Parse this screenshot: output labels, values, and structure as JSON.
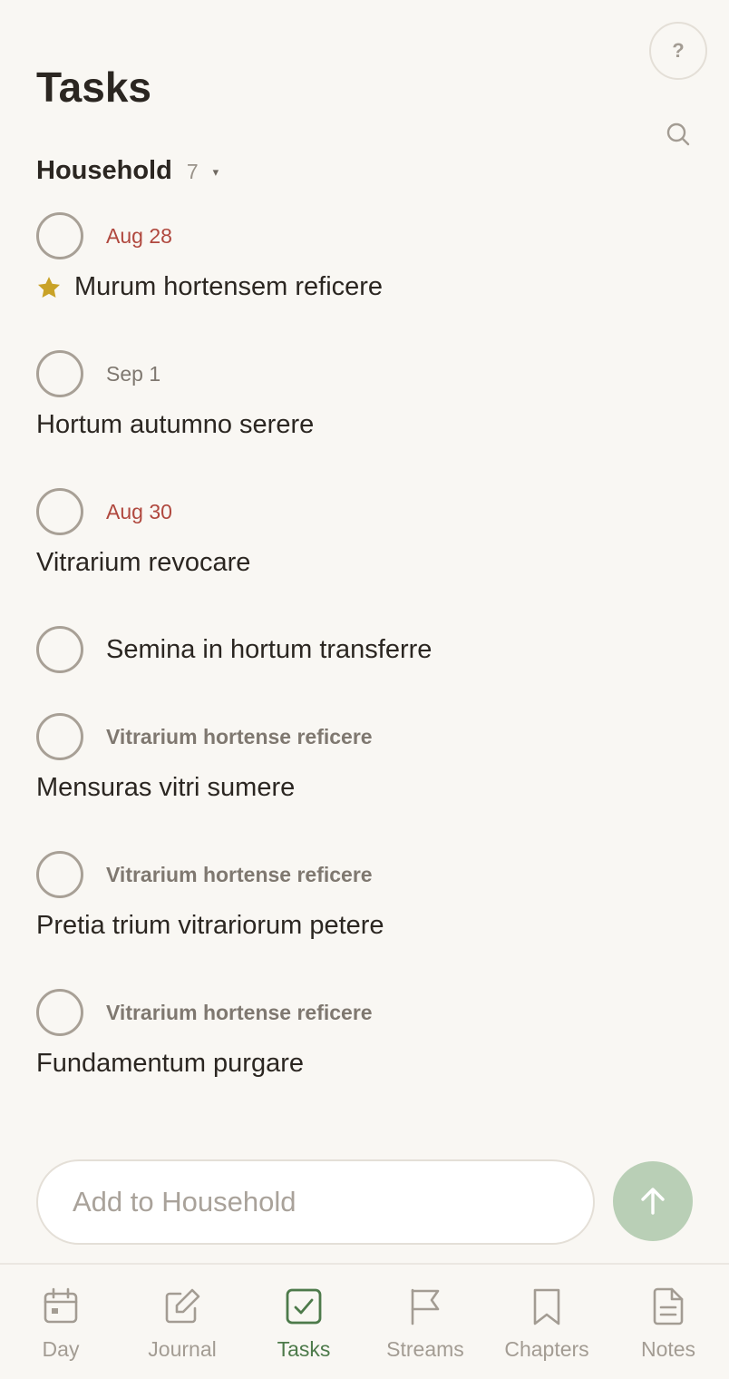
{
  "header": {
    "title": "Tasks",
    "help_label": "?"
  },
  "list": {
    "name": "Household",
    "count": "7",
    "caret": "▾"
  },
  "tasks": [
    {
      "meta": "Aug 28",
      "meta_type": "overdue",
      "title": "Murum hortensem reficere",
      "starred": true
    },
    {
      "meta": "Sep 1",
      "meta_type": "future",
      "title": "Hortum autumno serere"
    },
    {
      "meta": "Aug 30",
      "meta_type": "overdue",
      "title": "Vitrarium revocare"
    },
    {
      "meta": "",
      "meta_type": "none",
      "title": "Semina in hortum transferre"
    },
    {
      "meta": "Vitrarium hortense reficere",
      "meta_type": "parent",
      "title": "Mensuras vitri sumere"
    },
    {
      "meta": "Vitrarium hortense reficere",
      "meta_type": "parent",
      "title": "Pretia trium vitrariorum petere"
    },
    {
      "meta": "Vitrarium hortense reficere",
      "meta_type": "parent",
      "title": "Fundamentum purgare"
    }
  ],
  "composer": {
    "placeholder": "Add to Household"
  },
  "tabs": [
    {
      "label": "Day",
      "icon": "calendar-icon",
      "active": false
    },
    {
      "label": "Journal",
      "icon": "edit-icon",
      "active": false
    },
    {
      "label": "Tasks",
      "icon": "checkbox-icon",
      "active": true
    },
    {
      "label": "Streams",
      "icon": "flag-icon",
      "active": false
    },
    {
      "label": "Chapters",
      "icon": "bookmark-icon",
      "active": false
    },
    {
      "label": "Notes",
      "icon": "document-icon",
      "active": false
    }
  ],
  "colors": {
    "background": "#f9f7f3",
    "overdue": "#b0483e",
    "accent": "#4d7a4a",
    "send_button": "#b9cfb6",
    "star": "#c9a227"
  }
}
